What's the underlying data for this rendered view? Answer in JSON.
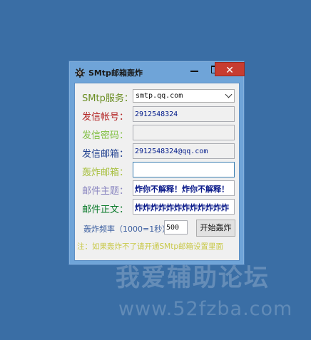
{
  "window": {
    "title": "SMtp邮箱轰炸",
    "close_glyph": "✕"
  },
  "form": {
    "smtp_label": "SMtp服务：",
    "smtp_value": "smtp.qq.com",
    "account_label": "发信帐号：",
    "account_value": "2912548324",
    "password_label": "发信密码：",
    "password_value": "",
    "sender_label": "发信邮箱：",
    "sender_value": "2912548324@qq.com",
    "target_label": "轰炸邮箱：",
    "target_value": "",
    "subject_label": "邮件主题：",
    "subject_value": "炸你不解释！炸你不解释！",
    "body_label": "邮件正文：",
    "body_value": "炸炸炸炸炸炸炸炸炸炸炸炸",
    "rate_label": "轰炸频率（1000=1秒）",
    "rate_value": "500",
    "start_button": "开始轰炸",
    "note": "注：如果轰炸不了请开通SMtp邮箱设置里面"
  },
  "watermark": {
    "text": "我爱辅助论坛",
    "url": "www.52fzba.com"
  },
  "colors": {
    "desktop": "#3a6ea5",
    "window_frame": "#6fa4d8",
    "close_button": "#c73c30",
    "smtp_label": "#6b8e23",
    "account_label": "#b22222",
    "password_label": "#7fbf3f",
    "sender_label": "#1f3f8f",
    "target_label": "#a8c040",
    "subject_label": "#8a86c0",
    "body_label": "#0a7a2a"
  }
}
